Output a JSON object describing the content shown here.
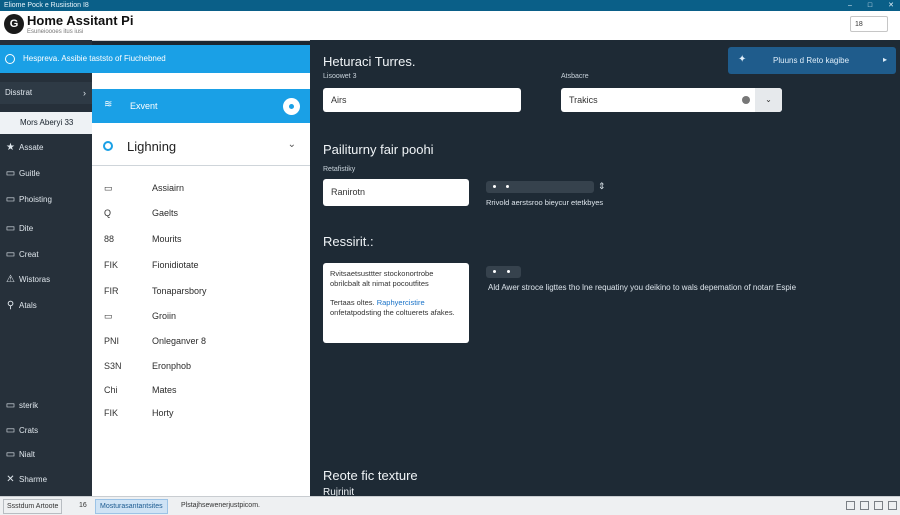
{
  "window": {
    "title": "Eliome Pock e Rusiistion I8",
    "controls": [
      "–",
      "□",
      "✕"
    ]
  },
  "header": {
    "logo_text": "G",
    "title": "Home Assitant Pi",
    "subtitle": "Esuneioooes itus iusi",
    "box_text": "18"
  },
  "banner": {
    "text": "Hespreva. Assibie taststo of Fiuchebned"
  },
  "sidebar": {
    "district_label": "Disstrat",
    "selected_label": "Mors Aberyi 33",
    "items": [
      {
        "icon": "★",
        "label": "Assate"
      },
      {
        "icon": "▭",
        "label": "Guitle"
      },
      {
        "icon": "▭",
        "label": "Phoisting"
      },
      {
        "icon": "▭",
        "label": "Dite"
      },
      {
        "icon": "▭",
        "label": "Creat"
      },
      {
        "icon": "⚠",
        "label": "Wistoras"
      },
      {
        "icon": "⚲",
        "label": "Atals"
      }
    ],
    "bottom_items": [
      {
        "icon": "▭",
        "label": "sterik"
      },
      {
        "icon": "▭",
        "label": "Crats"
      },
      {
        "icon": "▭",
        "label": "Nialt"
      },
      {
        "icon": "✕",
        "label": "Sharme"
      }
    ]
  },
  "list": {
    "header_label": "Exvent",
    "section_label": "Lighning",
    "items": [
      {
        "icon": "▭",
        "label": "Assiairn"
      },
      {
        "icon": "Q",
        "label": "Gaelts"
      },
      {
        "icon": "88",
        "label": "Mourits"
      },
      {
        "icon": "FIK",
        "label": "Fionidiotate"
      },
      {
        "icon": "FIR",
        "label": "Tonaparsbory"
      },
      {
        "icon": "▭",
        "label": "Groiin"
      },
      {
        "icon": "PNI",
        "label": "Onleganver 8"
      },
      {
        "icon": "S3N",
        "label": "Eronphob"
      },
      {
        "icon": "Chi",
        "label": "Mates"
      },
      {
        "icon": "FIK",
        "label": "Horty"
      }
    ]
  },
  "main": {
    "section1_title": "Heturaci Turres.",
    "field1_caption": "Lisoowet 3",
    "field1_value": "Airs",
    "field2_caption": "Atsbacre",
    "field2_value": "Trakics",
    "action_button": "Pluuns d Reto kagibe",
    "section2_title": "Pailiturny fair poohi",
    "field3_caption": "Retafistiky",
    "field3_value": "Ranirotn",
    "help_text": "Rrivold aerstsroo bieycur etetkbyes",
    "section3_title": "Ressirit.:",
    "card_text1": "Rvitsaetsusttter stockonortrobe obrilcbalt alt nimat pocoutfites",
    "card_text2a": "Tertaas oltes.",
    "card_link": "Raphyercistire",
    "card_text2b": "onfetatpodsting the coltuerets afakes.",
    "description": "Ald Awer stroce ligttes tho lne requatiny you deikino to wals depemation of notarr Espie",
    "section4_title": "Reote fic texture",
    "section4_cut": "Rujrinit"
  },
  "statusbar": {
    "item1": "Ssstdum Artoote",
    "item2": "16",
    "item3": "Mosturasantantsites",
    "item4": "Plstajhsewenerjustpicom."
  }
}
